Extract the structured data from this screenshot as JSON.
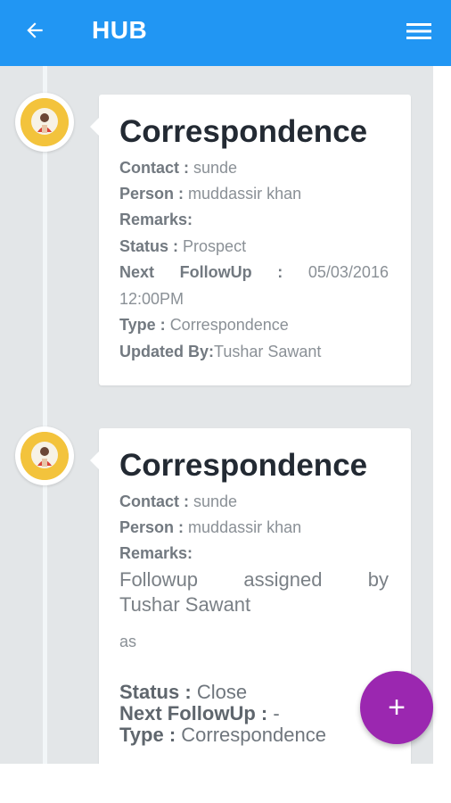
{
  "appbar": {
    "title": "HUB",
    "back_icon": "arrow-left-icon",
    "menu_icon": "hamburger-menu-icon",
    "color": "#2196f3"
  },
  "timeline": [
    {
      "title": "Correspondence",
      "contact_label": "Contact :",
      "contact_value": "sunde",
      "person_label": "Person :",
      "person_value": "muddassir khan",
      "remarks_label": "Remarks:",
      "status_label": "Status :",
      "status_value": "Prospect",
      "followup_word1": "Next",
      "followup_word2": "FollowUp",
      "followup_colon": ":",
      "followup_date": "05/03/2016",
      "followup_time": "12:00PM",
      "type_label": "Type :",
      "type_value": "Correspondence",
      "updated_label": "Updated By:",
      "updated_value": "Tushar Sawant"
    },
    {
      "title": "Correspondence",
      "contact_label": "Contact :",
      "contact_value": "sunde",
      "person_label": "Person :",
      "person_value": "muddassir khan",
      "remarks_label": "Remarks:",
      "remarks_words": [
        "Followup",
        "assigned",
        "by"
      ],
      "remarks_line2": "Tushar Sawant",
      "remarks_note": "as",
      "status_label": "Status :",
      "status_value": "Close",
      "followup_label": "Next FollowUp :",
      "followup_value": "-",
      "type_label": "Type :",
      "type_value": "Correspondence"
    }
  ],
  "fab": {
    "label": "+",
    "color": "#9b27b0"
  }
}
